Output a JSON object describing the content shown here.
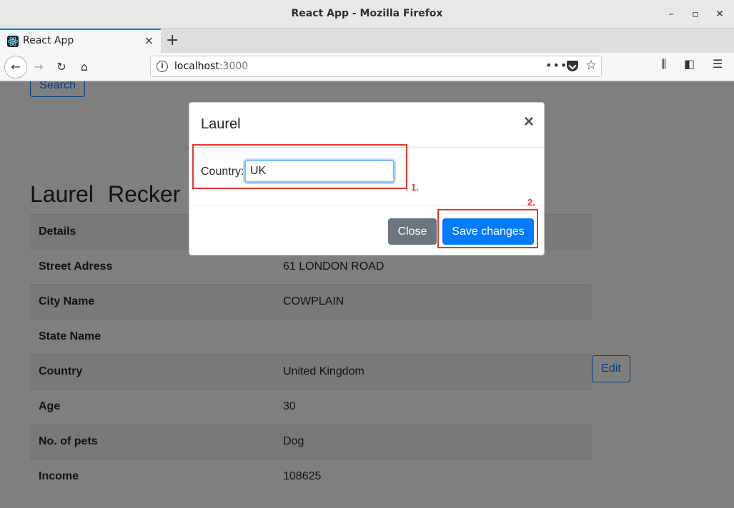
{
  "window": {
    "title": "React App - Mozilla Firefox"
  },
  "tab": {
    "label": "React App",
    "close": "×",
    "new_tab": "+"
  },
  "nav": {
    "url_host": "localhost",
    "url_port": ":3000",
    "page_actions": "•••"
  },
  "page": {
    "search_label": "Search",
    "person": {
      "first_name": "Laurel",
      "last_name": "Recker"
    },
    "table": {
      "rows": [
        {
          "key": "Details",
          "value": ""
        },
        {
          "key": "Street Adress",
          "value": "61 LONDON ROAD"
        },
        {
          "key": "City Name",
          "value": "COWPLAIN"
        },
        {
          "key": "State Name",
          "value": ""
        },
        {
          "key": "Country",
          "value": "United Kingdom"
        },
        {
          "key": "Age",
          "value": "30"
        },
        {
          "key": "No. of pets",
          "value": "Dog"
        },
        {
          "key": "Income",
          "value": "108625"
        }
      ]
    },
    "edit_label": "Edit"
  },
  "modal": {
    "title": "Laurel",
    "close_icon": "×",
    "field_label": "Country:",
    "field_value": "UK",
    "close_label": "Close",
    "save_label": "Save changes"
  },
  "annotations": {
    "step1": "1.",
    "step2": "2."
  },
  "colors": {
    "accent": "#007bff",
    "annotation": "#e8372c",
    "secondary": "#6c757d"
  }
}
